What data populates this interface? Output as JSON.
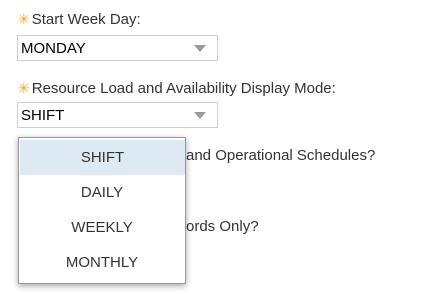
{
  "start_week_day": {
    "label": "Start Week Day:",
    "value": "MONDAY"
  },
  "display_mode": {
    "label": "Resource Load and Availability Display Mode:",
    "value": "SHIFT",
    "options": [
      "SHIFT",
      "DAILY",
      "WEEKLY",
      "MONTHLY"
    ]
  },
  "partially_hidden": {
    "question_1_fragment": "and Operational Schedules?",
    "question_2_fragment": "ords Only?"
  },
  "required_marker": "✳",
  "colors": {
    "required": "#f5a623",
    "selected_option_bg": "#dde9f3",
    "border": "#cfcfcf"
  }
}
